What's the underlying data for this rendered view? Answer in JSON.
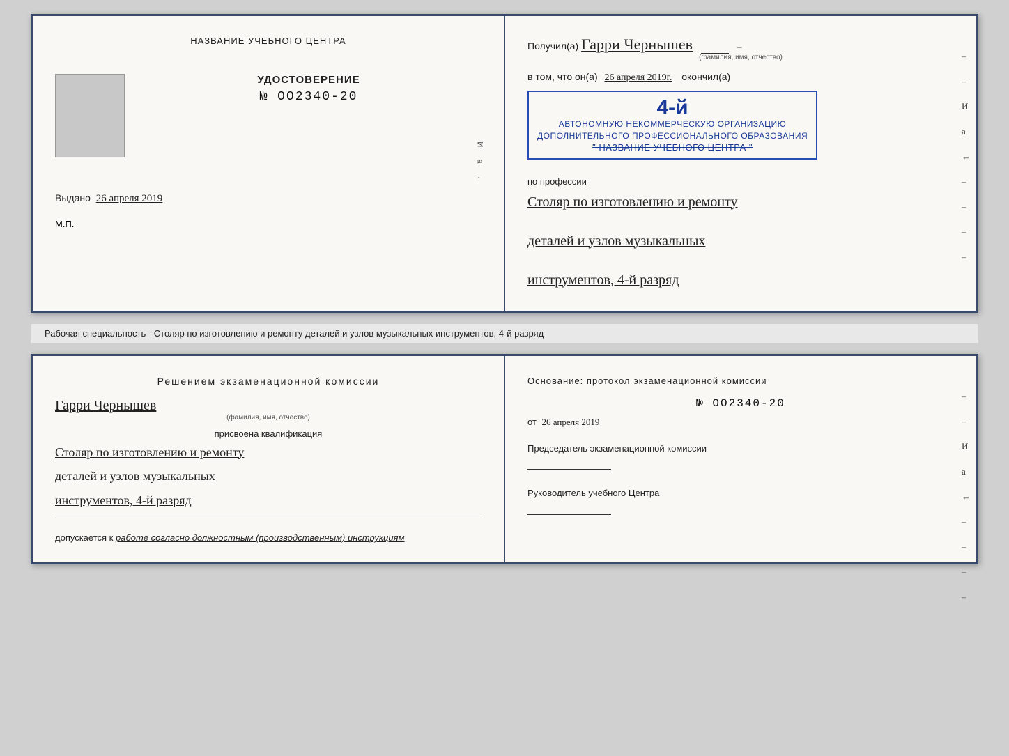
{
  "top_left": {
    "title": "НАЗВАНИЕ УЧЕБНОГО ЦЕНТРА",
    "udostoverenie_label": "УДОСТОВЕРЕНИЕ",
    "udostoverenie_number": "№ OO2340-20",
    "vydano_label": "Выдано",
    "vydano_date": "26 апреля 2019",
    "mp": "М.П."
  },
  "top_right": {
    "poluchil_prefix": "Получил(а)",
    "name_handwritten": "Гарри Чернышев",
    "name_label": "(фамилия, имя, отчество)",
    "vtom_prefix": "в том, что он(а)",
    "date_handwritten": "26 апреля 2019г.",
    "okonchil": "окончил(а)",
    "stamp_big": "4-й",
    "stamp_line1": "АВТОНОМНУЮ НЕКОММЕРЧЕСКУЮ ОРГАНИЗАЦИЮ",
    "stamp_line2": "ДОПОЛНИТЕЛЬНОГО ПРОФЕССИОНАЛЬНОГО ОБРАЗОВАНИЯ",
    "stamp_line3": "\" НАЗВАНИЕ УЧЕБНОГО ЦЕНТРА \"",
    "po_professii": "по профессии",
    "profession_line1": "Столяр по изготовлению и ремонту",
    "profession_line2": "деталей и узлов музыкальных",
    "profession_line3": "инструментов, 4-й разряд"
  },
  "caption": "Рабочая специальность - Столяр по изготовлению и ремонту деталей и узлов музыкальных инструментов, 4-й разряд",
  "bottom_left": {
    "resolution_title": "Решением  экзаменационной  комиссии",
    "name_handwritten": "Гарри Чернышев",
    "name_label": "(фамилия, имя, отчество)",
    "prisvoena": "присвоена квалификация",
    "qualification_line1": "Столяр по изготовлению и ремонту",
    "qualification_line2": "деталей и узлов музыкальных",
    "qualification_line3": "инструментов, 4-й разряд",
    "dopuskaetsya_prefix": "допускается к",
    "dopuskaetsya_italic": "работе согласно должностным (производственным) инструкциям"
  },
  "bottom_right": {
    "osnovaniye": "Основание:  протокол  экзаменационной  комиссии",
    "protocol_number": "№  OO2340-20",
    "ot_prefix": "от",
    "ot_date": "26 апреля 2019",
    "predsedatel_label": "Председатель экзаменационной комиссии",
    "rukovoditel_label": "Руководитель учебного Центра"
  },
  "vertical_chars": "И а ←"
}
